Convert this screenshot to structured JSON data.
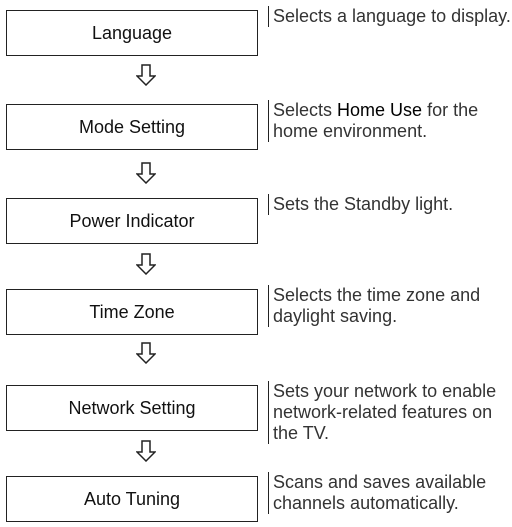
{
  "steps": [
    {
      "label": "Language",
      "desc": "Selects a language to display."
    },
    {
      "label": "Mode Setting",
      "desc_pre": "Selects ",
      "desc_bold": "Home Use",
      "desc_post": " for the home environment."
    },
    {
      "label": "Power Indicator",
      "desc": "Sets the Standby light."
    },
    {
      "label": "Time Zone",
      "desc": "Selects the time zone and daylight saving."
    },
    {
      "label": "Network Setting",
      "desc": "Sets your network to enable network-related features on the TV."
    },
    {
      "label": "Auto Tuning",
      "desc": "Scans and saves available channels automatically."
    }
  ],
  "arrow_icon": "hollow-down-arrow-icon"
}
